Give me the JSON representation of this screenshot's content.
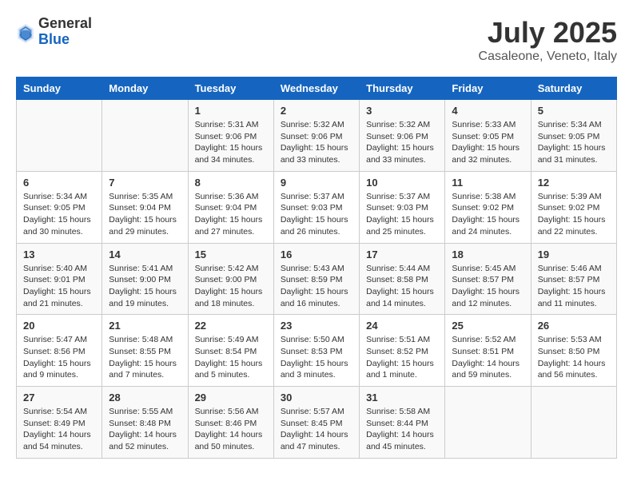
{
  "logo": {
    "general": "General",
    "blue": "Blue"
  },
  "header": {
    "month": "July 2025",
    "location": "Casaleone, Veneto, Italy"
  },
  "days_of_week": [
    "Sunday",
    "Monday",
    "Tuesday",
    "Wednesday",
    "Thursday",
    "Friday",
    "Saturday"
  ],
  "weeks": [
    [
      {
        "day": "",
        "content": ""
      },
      {
        "day": "",
        "content": ""
      },
      {
        "day": "1",
        "content": "Sunrise: 5:31 AM\nSunset: 9:06 PM\nDaylight: 15 hours and 34 minutes."
      },
      {
        "day": "2",
        "content": "Sunrise: 5:32 AM\nSunset: 9:06 PM\nDaylight: 15 hours and 33 minutes."
      },
      {
        "day": "3",
        "content": "Sunrise: 5:32 AM\nSunset: 9:06 PM\nDaylight: 15 hours and 33 minutes."
      },
      {
        "day": "4",
        "content": "Sunrise: 5:33 AM\nSunset: 9:05 PM\nDaylight: 15 hours and 32 minutes."
      },
      {
        "day": "5",
        "content": "Sunrise: 5:34 AM\nSunset: 9:05 PM\nDaylight: 15 hours and 31 minutes."
      }
    ],
    [
      {
        "day": "6",
        "content": "Sunrise: 5:34 AM\nSunset: 9:05 PM\nDaylight: 15 hours and 30 minutes."
      },
      {
        "day": "7",
        "content": "Sunrise: 5:35 AM\nSunset: 9:04 PM\nDaylight: 15 hours and 29 minutes."
      },
      {
        "day": "8",
        "content": "Sunrise: 5:36 AM\nSunset: 9:04 PM\nDaylight: 15 hours and 27 minutes."
      },
      {
        "day": "9",
        "content": "Sunrise: 5:37 AM\nSunset: 9:03 PM\nDaylight: 15 hours and 26 minutes."
      },
      {
        "day": "10",
        "content": "Sunrise: 5:37 AM\nSunset: 9:03 PM\nDaylight: 15 hours and 25 minutes."
      },
      {
        "day": "11",
        "content": "Sunrise: 5:38 AM\nSunset: 9:02 PM\nDaylight: 15 hours and 24 minutes."
      },
      {
        "day": "12",
        "content": "Sunrise: 5:39 AM\nSunset: 9:02 PM\nDaylight: 15 hours and 22 minutes."
      }
    ],
    [
      {
        "day": "13",
        "content": "Sunrise: 5:40 AM\nSunset: 9:01 PM\nDaylight: 15 hours and 21 minutes."
      },
      {
        "day": "14",
        "content": "Sunrise: 5:41 AM\nSunset: 9:00 PM\nDaylight: 15 hours and 19 minutes."
      },
      {
        "day": "15",
        "content": "Sunrise: 5:42 AM\nSunset: 9:00 PM\nDaylight: 15 hours and 18 minutes."
      },
      {
        "day": "16",
        "content": "Sunrise: 5:43 AM\nSunset: 8:59 PM\nDaylight: 15 hours and 16 minutes."
      },
      {
        "day": "17",
        "content": "Sunrise: 5:44 AM\nSunset: 8:58 PM\nDaylight: 15 hours and 14 minutes."
      },
      {
        "day": "18",
        "content": "Sunrise: 5:45 AM\nSunset: 8:57 PM\nDaylight: 15 hours and 12 minutes."
      },
      {
        "day": "19",
        "content": "Sunrise: 5:46 AM\nSunset: 8:57 PM\nDaylight: 15 hours and 11 minutes."
      }
    ],
    [
      {
        "day": "20",
        "content": "Sunrise: 5:47 AM\nSunset: 8:56 PM\nDaylight: 15 hours and 9 minutes."
      },
      {
        "day": "21",
        "content": "Sunrise: 5:48 AM\nSunset: 8:55 PM\nDaylight: 15 hours and 7 minutes."
      },
      {
        "day": "22",
        "content": "Sunrise: 5:49 AM\nSunset: 8:54 PM\nDaylight: 15 hours and 5 minutes."
      },
      {
        "day": "23",
        "content": "Sunrise: 5:50 AM\nSunset: 8:53 PM\nDaylight: 15 hours and 3 minutes."
      },
      {
        "day": "24",
        "content": "Sunrise: 5:51 AM\nSunset: 8:52 PM\nDaylight: 15 hours and 1 minute."
      },
      {
        "day": "25",
        "content": "Sunrise: 5:52 AM\nSunset: 8:51 PM\nDaylight: 14 hours and 59 minutes."
      },
      {
        "day": "26",
        "content": "Sunrise: 5:53 AM\nSunset: 8:50 PM\nDaylight: 14 hours and 56 minutes."
      }
    ],
    [
      {
        "day": "27",
        "content": "Sunrise: 5:54 AM\nSunset: 8:49 PM\nDaylight: 14 hours and 54 minutes."
      },
      {
        "day": "28",
        "content": "Sunrise: 5:55 AM\nSunset: 8:48 PM\nDaylight: 14 hours and 52 minutes."
      },
      {
        "day": "29",
        "content": "Sunrise: 5:56 AM\nSunset: 8:46 PM\nDaylight: 14 hours and 50 minutes."
      },
      {
        "day": "30",
        "content": "Sunrise: 5:57 AM\nSunset: 8:45 PM\nDaylight: 14 hours and 47 minutes."
      },
      {
        "day": "31",
        "content": "Sunrise: 5:58 AM\nSunset: 8:44 PM\nDaylight: 14 hours and 45 minutes."
      },
      {
        "day": "",
        "content": ""
      },
      {
        "day": "",
        "content": ""
      }
    ]
  ]
}
